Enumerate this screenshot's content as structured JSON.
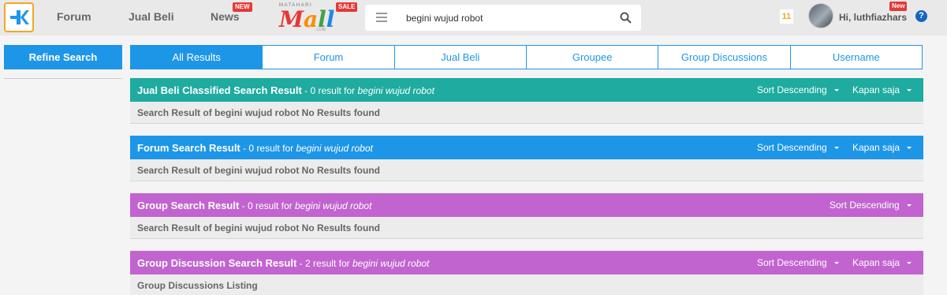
{
  "topbar": {
    "nav": [
      {
        "label": "Forum"
      },
      {
        "label": "Jual Beli"
      },
      {
        "label": "News",
        "badge": "NEW"
      }
    ],
    "mall": {
      "top": "MATAHARI",
      "word": [
        "M",
        "a",
        "l",
        "l"
      ],
      "com": ".COM",
      "badge": "SALE"
    },
    "search": {
      "value": "begini wujud robot",
      "icon": "search-icon"
    },
    "notifications": "11",
    "user": {
      "greeting": "Hi, luthfiazhars",
      "badge": "New"
    },
    "help": "?"
  },
  "sidebar": {
    "refine_label": "Refine Search"
  },
  "tabs": [
    {
      "label": "All Results",
      "active": true
    },
    {
      "label": "Forum"
    },
    {
      "label": "Jual Beli"
    },
    {
      "label": "Groupee"
    },
    {
      "label": "Group Discussions"
    },
    {
      "label": "Username"
    }
  ],
  "sections": [
    {
      "title": "Jual Beli Classified Search Result",
      "count": " - 0 result for ",
      "query": "begini wujud robot",
      "sort": "Sort Descending",
      "time": "Kapan saja",
      "body": "Search Result of begini wujud robot No Results found",
      "color": "#1fab9f"
    },
    {
      "title": "Forum Search Result",
      "count": " - 0 result for ",
      "query": "begini wujud robot",
      "sort": "Sort Descending",
      "time": "Kapan saja",
      "body": "Search Result of begini wujud robot No Results found",
      "color": "#1e96e8"
    },
    {
      "title": "Group Search Result",
      "count": " - 0 result for ",
      "query": "begini wujud robot",
      "sort": "Sort Descending",
      "body": "Search Result of begini wujud robot No Results found",
      "color": "#c264d0"
    },
    {
      "title": "Group Discussion Search Result",
      "count": " - 2 result for ",
      "query": "begini wujud robot",
      "sort": "Sort Descending",
      "time": "Kapan saja",
      "body": "Group Discussions Listing",
      "color": "#c264d0"
    }
  ]
}
